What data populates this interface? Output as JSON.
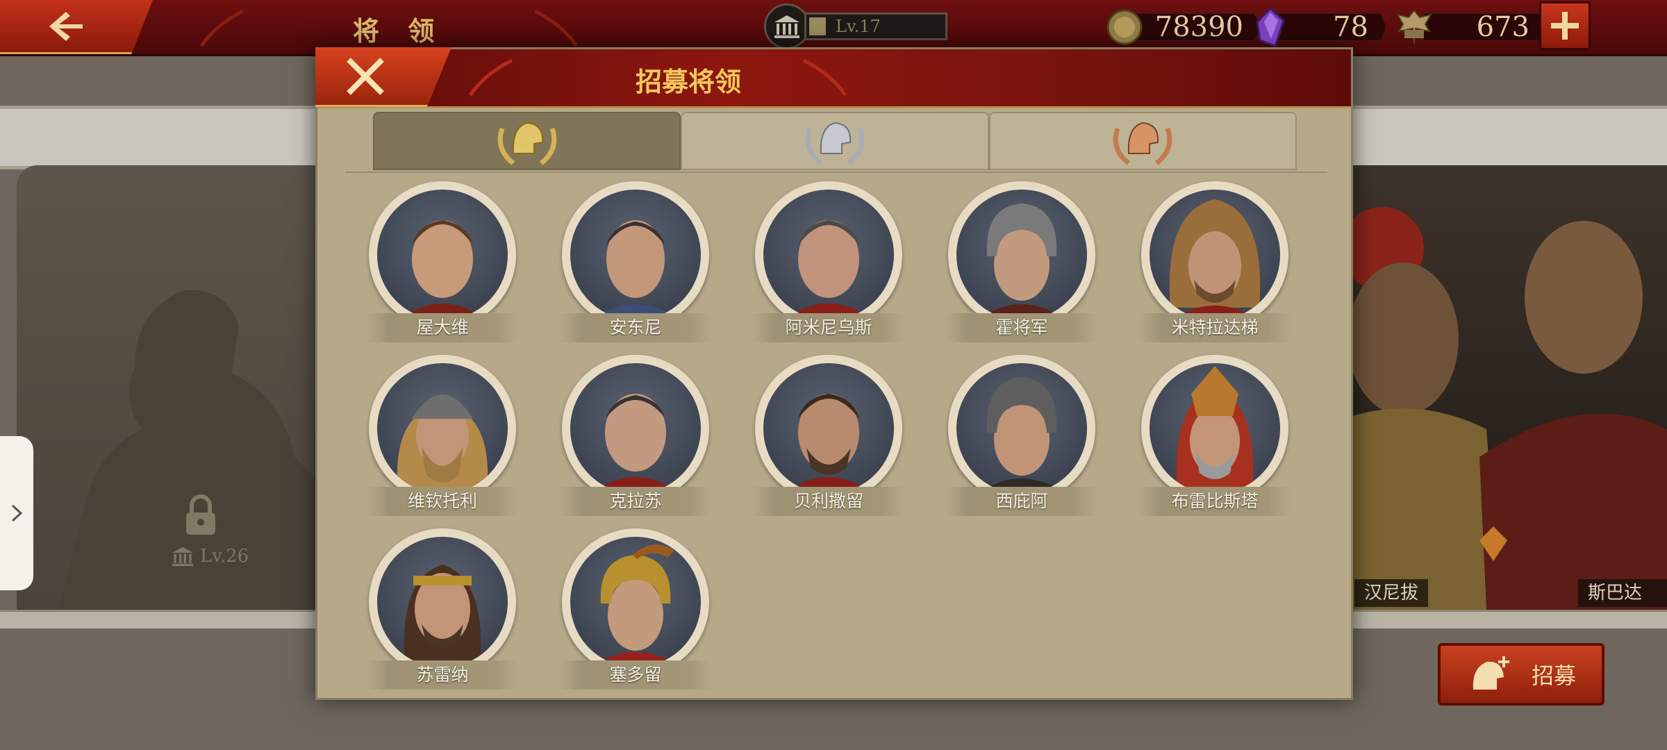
{
  "topbar": {
    "page_title": "将 领",
    "player_level": "Lv.17",
    "resources": {
      "coins": "78390",
      "gems": "78",
      "spqr": "673"
    }
  },
  "background": {
    "locked_slot_level": "Lv.26",
    "right_labels": [
      "汉尼拔",
      "斯巴达克"
    ]
  },
  "recruit_button_label": "招募",
  "modal": {
    "title": "招募将领",
    "tabs": [
      "gold-rank",
      "silver-rank",
      "bronze-rank"
    ],
    "active_tab": 0,
    "generals": [
      {
        "name": "屋大维"
      },
      {
        "name": "安东尼"
      },
      {
        "name": "阿米尼乌斯"
      },
      {
        "name": "霍将军"
      },
      {
        "name": "米特拉达梯"
      },
      {
        "name": "维钦托利"
      },
      {
        "name": "克拉苏"
      },
      {
        "name": "贝利撒留"
      },
      {
        "name": "西庇阿"
      },
      {
        "name": "布雷比斯塔"
      },
      {
        "name": "苏雷纳"
      },
      {
        "name": "塞多留"
      }
    ]
  },
  "colors": {
    "accent_red": "#8d170f",
    "title_gold": "#f4c75a",
    "panel_parchment": "#b5a98a"
  }
}
